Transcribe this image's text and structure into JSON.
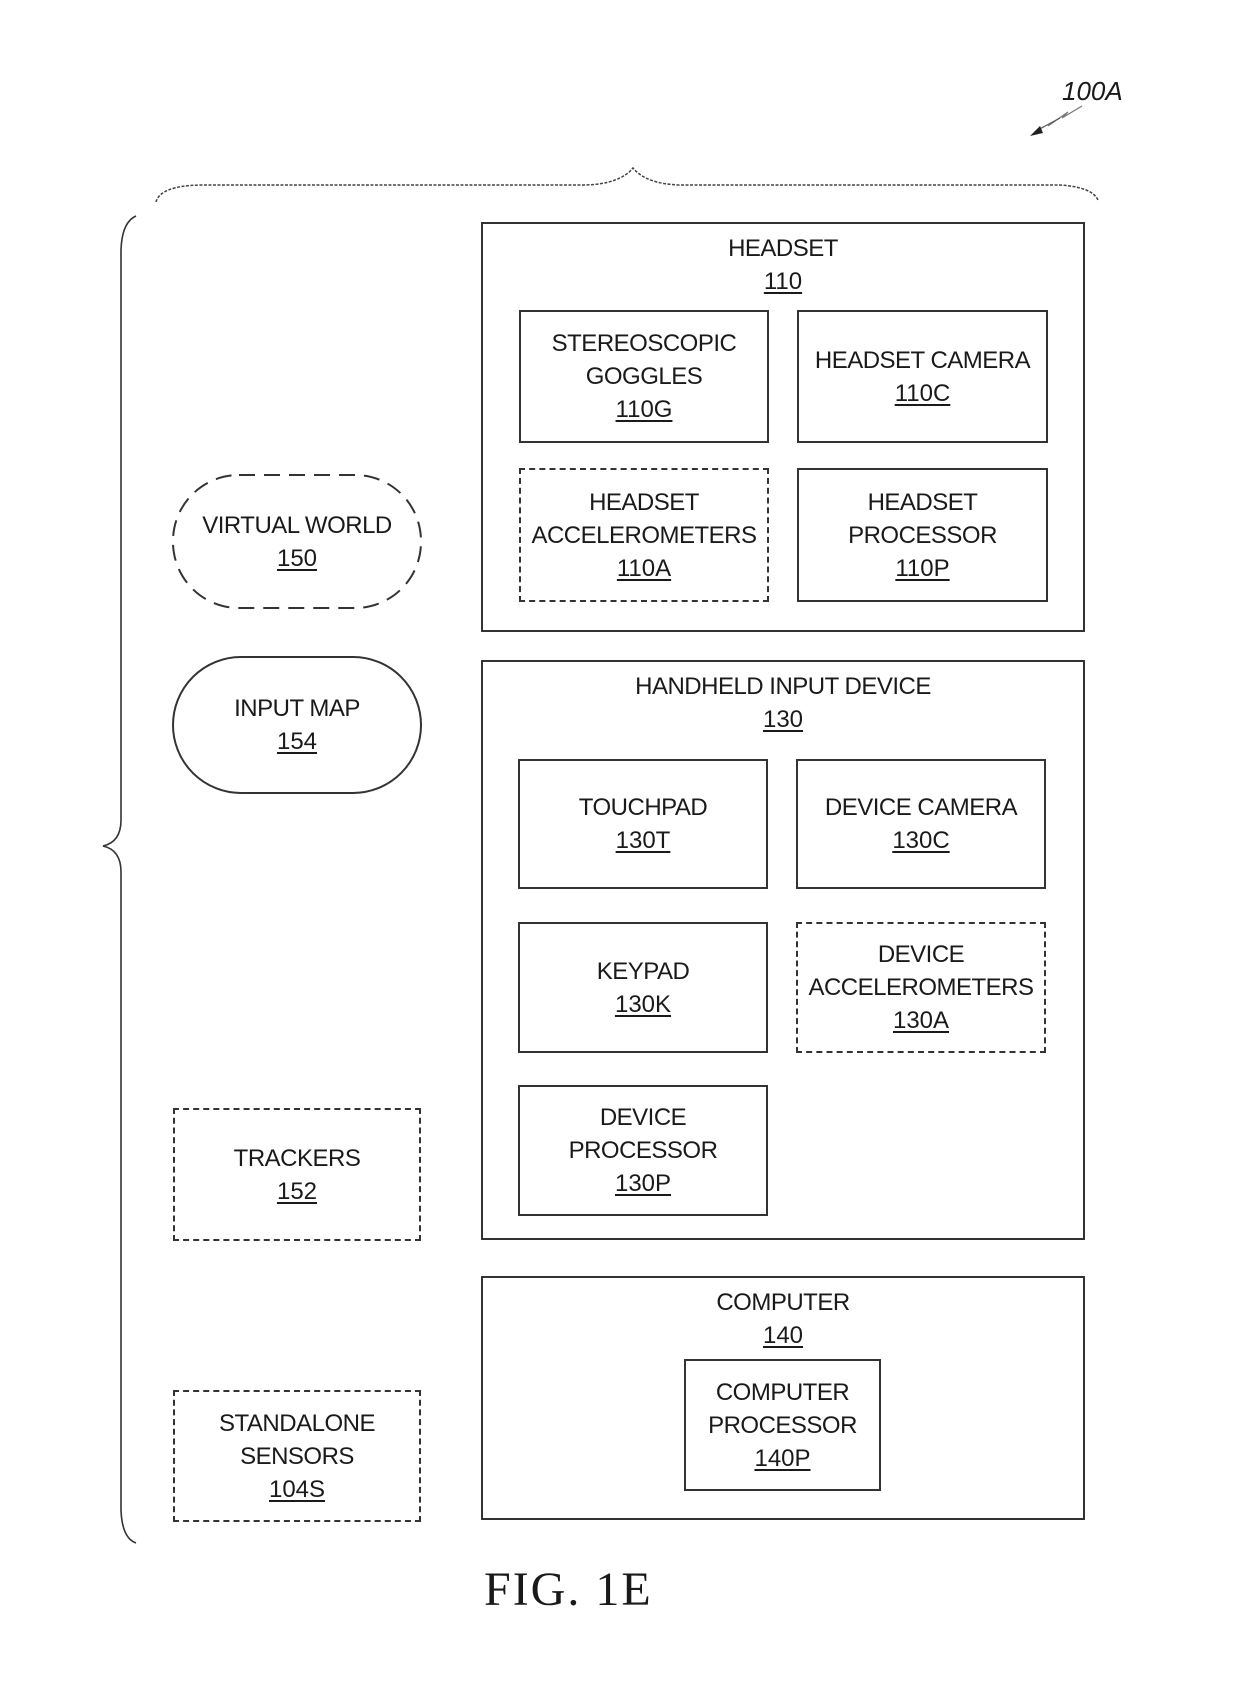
{
  "figure": {
    "reference": "100A",
    "caption": "FIG. 1E"
  },
  "left_column": {
    "virtual_world": {
      "label": "VIRTUAL WORLD",
      "ref": "150",
      "style": "dashed-oval"
    },
    "input_map": {
      "label": "INPUT MAP",
      "ref": "154",
      "style": "solid-oval"
    },
    "trackers": {
      "label": "TRACKERS",
      "ref": "152",
      "style": "dashed-box"
    },
    "standalone_sensors": {
      "label_line1": "STANDALONE",
      "label_line2": "SENSORS",
      "ref": "104S",
      "style": "dashed-box"
    }
  },
  "headset": {
    "label": "HEADSET",
    "ref": "110",
    "components": {
      "goggles": {
        "label_line1": "STEREOSCOPIC",
        "label_line2": "GOGGLES",
        "ref": "110G"
      },
      "camera": {
        "label": "HEADSET CAMERA",
        "ref": "110C"
      },
      "accelerometers": {
        "label_line1": "HEADSET",
        "label_line2": "ACCELEROMETERS",
        "ref": "110A",
        "style": "dashed"
      },
      "processor": {
        "label_line1": "HEADSET",
        "label_line2": "PROCESSOR",
        "ref": "110P"
      }
    }
  },
  "handheld": {
    "label": "HANDHELD INPUT DEVICE",
    "ref": "130",
    "components": {
      "touchpad": {
        "label": "TOUCHPAD",
        "ref": "130T"
      },
      "camera": {
        "label": "DEVICE CAMERA",
        "ref": "130C"
      },
      "keypad": {
        "label": "KEYPAD",
        "ref": "130K"
      },
      "accelerometers": {
        "label_line1": "DEVICE",
        "label_line2": "ACCELEROMETERS",
        "ref": "130A",
        "style": "dashed"
      },
      "processor": {
        "label_line1": "DEVICE",
        "label_line2": "PROCESSOR",
        "ref": "130P"
      }
    }
  },
  "computer": {
    "label": "COMPUTER",
    "ref": "140",
    "components": {
      "processor": {
        "label_line1": "COMPUTER",
        "label_line2": "PROCESSOR",
        "ref": "140P"
      }
    }
  }
}
